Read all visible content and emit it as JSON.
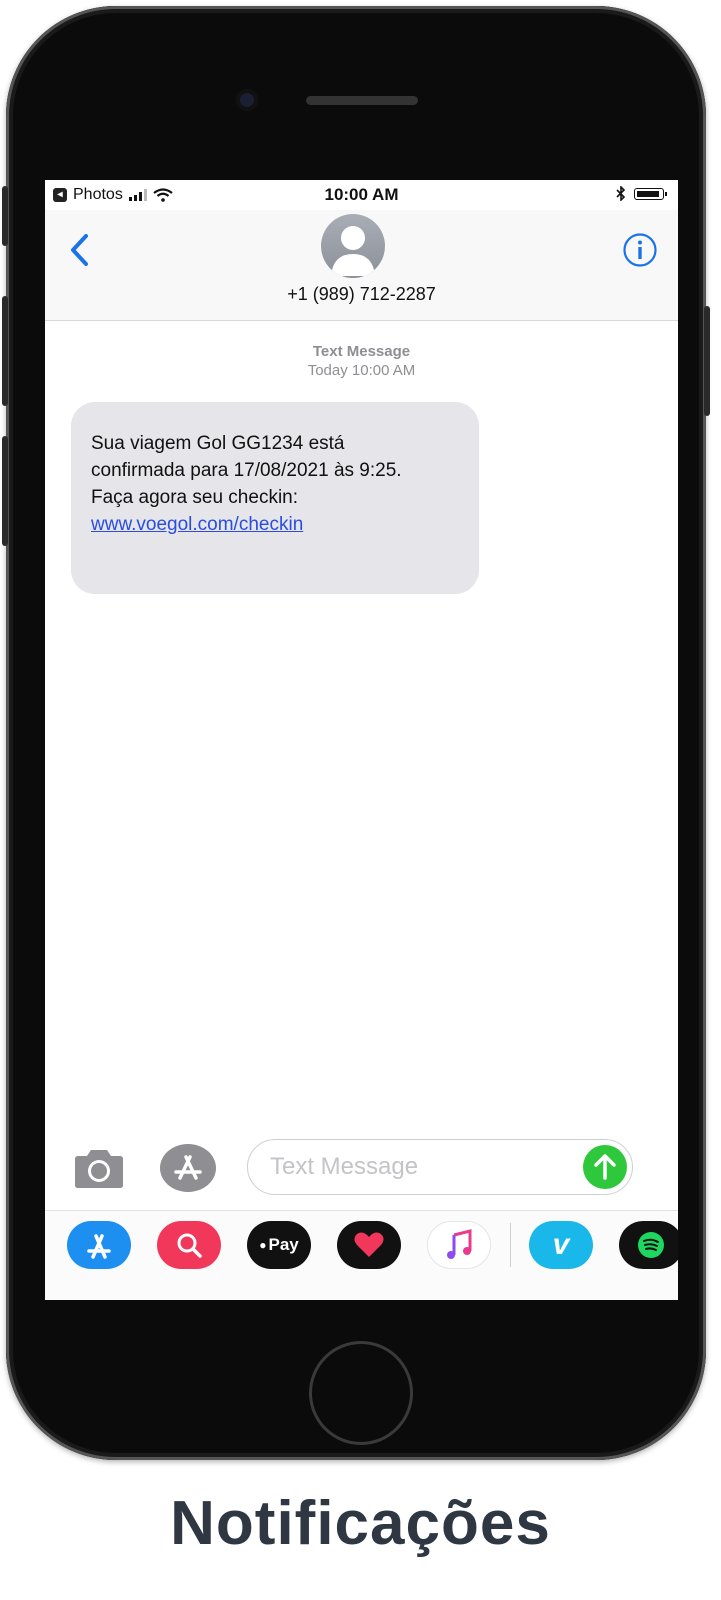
{
  "status_bar": {
    "back_app": "Photos",
    "time": "10:00 AM"
  },
  "header": {
    "contact": "+1 (989) 712-2287"
  },
  "conversation": {
    "service": "Text Message",
    "timestamp": "Today 10:00 AM",
    "message_line1": "Sua viagem Gol GG1234 está",
    "message_line2": "confirmada para 17/08/2021 às 9:25.",
    "message_line3": "Faça agora seu checkin:",
    "message_link": "www.voegol.com/checkin"
  },
  "composer": {
    "placeholder": "Text Message"
  },
  "app_drawer": {
    "apple_pay_label": "Pay",
    "vimeo_label": "v"
  },
  "caption": "Notificações"
}
